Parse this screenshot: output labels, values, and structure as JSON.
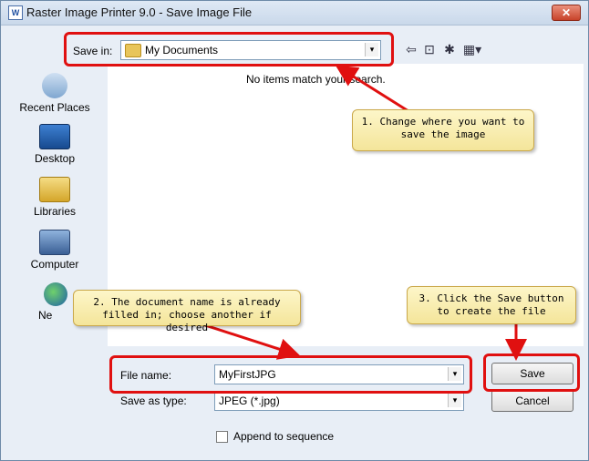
{
  "window": {
    "title": "Raster Image Printer 9.0 - Save Image File",
    "close_glyph": "✕",
    "app_icon_glyph": "W"
  },
  "toolbar": {
    "save_in_label": "Save in:",
    "save_in_value": "My Documents",
    "combo_arrow": "▾",
    "back_glyph": "⇦",
    "up_folder_glyph": "⊡",
    "new_folder_glyph": "✱",
    "views_glyph": "▦▾"
  },
  "places": [
    {
      "label": "Recent Places",
      "icon": "recent-places-icon"
    },
    {
      "label": "Desktop",
      "icon": "desktop-icon"
    },
    {
      "label": "Libraries",
      "icon": "libraries-icon"
    },
    {
      "label": "Computer",
      "icon": "computer-icon"
    },
    {
      "label": "Ne",
      "icon": "network-icon"
    }
  ],
  "filelist": {
    "empty_message": "No items match your search."
  },
  "form": {
    "file_name_label": "File name:",
    "file_name_value": "MyFirstJPG",
    "save_as_type_label": "Save as type:",
    "save_as_type_value": "JPEG (*.jpg)",
    "append_label": "Append to sequence",
    "append_checked": false
  },
  "buttons": {
    "save": "Save",
    "cancel": "Cancel"
  },
  "callouts": {
    "one": "1. Change where you want to save the image",
    "two": "2. The document name is already filled in; choose another if desired",
    "three": "3. Click the Save button to create the file"
  },
  "colors": {
    "highlight": "#e01010",
    "callout_bg": "#f8eeb4"
  }
}
